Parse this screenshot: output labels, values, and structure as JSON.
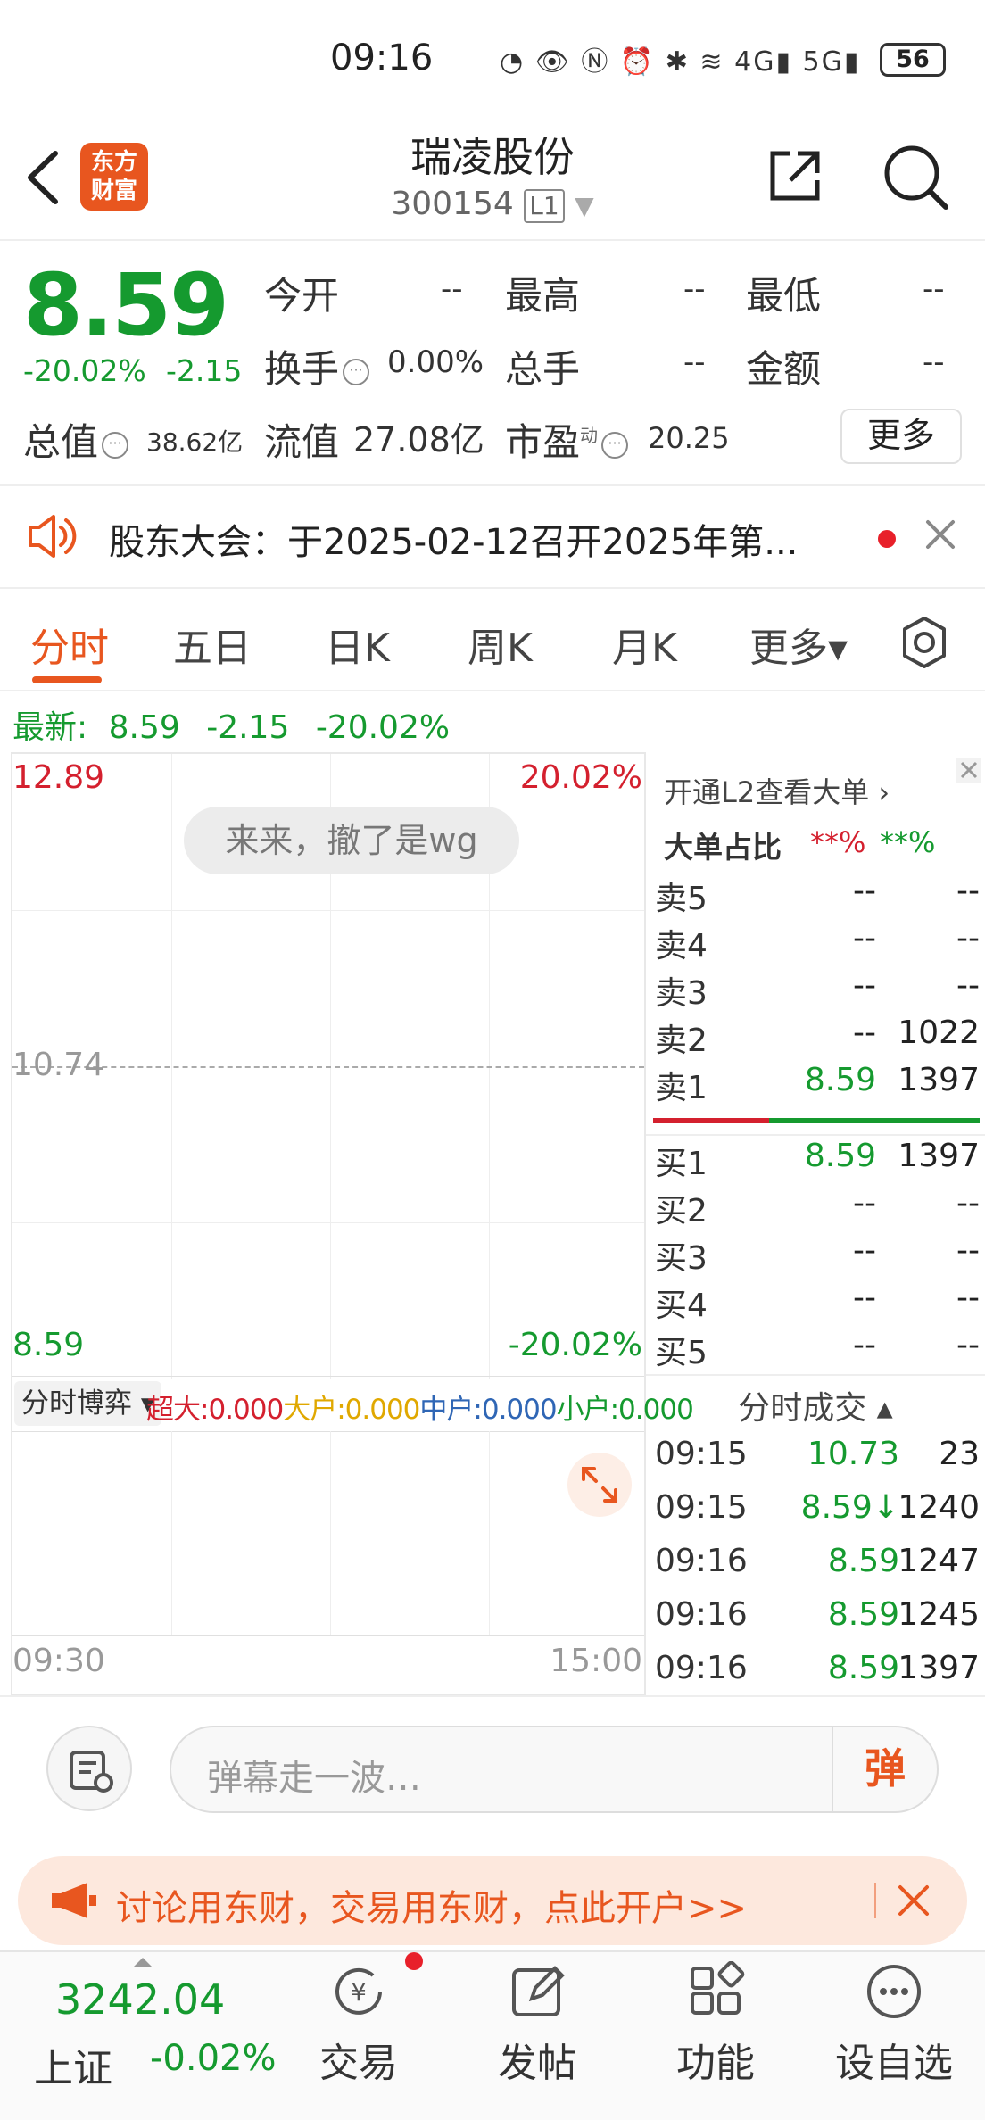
{
  "status": {
    "time": "09:16",
    "icons": "◔ 👁 Ⓝ ⏰ ✱ ≋ 4G▮ 5G▮",
    "battery": "56"
  },
  "header": {
    "title": "瑞凌股份",
    "code": "300154",
    "level": "L1"
  },
  "quote": {
    "price": "8.59",
    "change_pct": "-20.02%",
    "change": "-2.15",
    "open_label": "今开",
    "open": "--",
    "high_label": "最高",
    "high": "--",
    "low_label": "最低",
    "low": "--",
    "turnover_label": "换手",
    "turnover": "0.00%",
    "volume_label": "总手",
    "volume": "--",
    "amount_label": "金额",
    "amount": "--",
    "mcap_label": "总值",
    "mcap": "38.62亿",
    "float_label": "流值",
    "float": "27.08亿",
    "pe_label": "市盈",
    "pe_sup": "动",
    "pe": "20.25",
    "more": "更多"
  },
  "notice": {
    "text": "股东大会：于2025-02-12召开2025年第..."
  },
  "tabs": [
    "分时",
    "五日",
    "日K",
    "周K",
    "月K",
    "更多▾"
  ],
  "latest": {
    "label": "最新:",
    "price": "8.59",
    "change": "-2.15",
    "pct": "-20.02%"
  },
  "chart": {
    "top_price": "12.89",
    "top_pct": "20.02%",
    "mid_price": "10.74",
    "bottom_price": "8.59",
    "bottom_pct": "-20.02%",
    "start_time": "09:30",
    "end_time": "15:00",
    "toast": "来来，撤了是wg"
  },
  "boyi": {
    "selector": "分时博弈 ▾",
    "super": "超大:0.000",
    "big": "大户:0.000",
    "mid": "中户:0.000",
    "small": "小户:0.000"
  },
  "l2": {
    "link": "开通L2查看大单 ›",
    "ratio_label": "大单占比",
    "ratio_red": "**%",
    "ratio_green": "**%"
  },
  "orderbook": {
    "asks": [
      {
        "label": "卖5",
        "price": "--",
        "vol": "--"
      },
      {
        "label": "卖4",
        "price": "--",
        "vol": "--"
      },
      {
        "label": "卖3",
        "price": "--",
        "vol": "--"
      },
      {
        "label": "卖2",
        "price": "--",
        "vol": "1022"
      },
      {
        "label": "卖1",
        "price": "8.59",
        "vol": "1397"
      }
    ],
    "bids": [
      {
        "label": "买1",
        "price": "8.59",
        "vol": "1397"
      },
      {
        "label": "买2",
        "price": "--",
        "vol": "--"
      },
      {
        "label": "买3",
        "price": "--",
        "vol": "--"
      },
      {
        "label": "买4",
        "price": "--",
        "vol": "--"
      },
      {
        "label": "买5",
        "price": "--",
        "vol": "--"
      }
    ]
  },
  "trades": {
    "title": "分时成交 ▴",
    "rows": [
      {
        "time": "09:15",
        "price": "10.73",
        "vol": "23"
      },
      {
        "time": "09:15",
        "price": "8.59↓",
        "vol": "1240"
      },
      {
        "time": "09:16",
        "price": "8.59",
        "vol": "1247"
      },
      {
        "time": "09:16",
        "price": "8.59",
        "vol": "1245"
      },
      {
        "time": "09:16",
        "price": "8.59",
        "vol": "1397"
      }
    ]
  },
  "danmu": {
    "placeholder": "弹幕走一波…",
    "button": "弹"
  },
  "banner": {
    "text": "讨论用东财，交易用东财，点此开户>>"
  },
  "bottom": {
    "index_value": "3242.04",
    "index_name": "上证",
    "index_pct": "-0.02%",
    "trade": "交易",
    "post": "发帖",
    "func": "功能",
    "watch": "设自选"
  },
  "logo": {
    "text": "东方财富"
  },
  "colors": {
    "accent": "#e8561f",
    "down": "#159a2f",
    "up": "#d4202e"
  }
}
